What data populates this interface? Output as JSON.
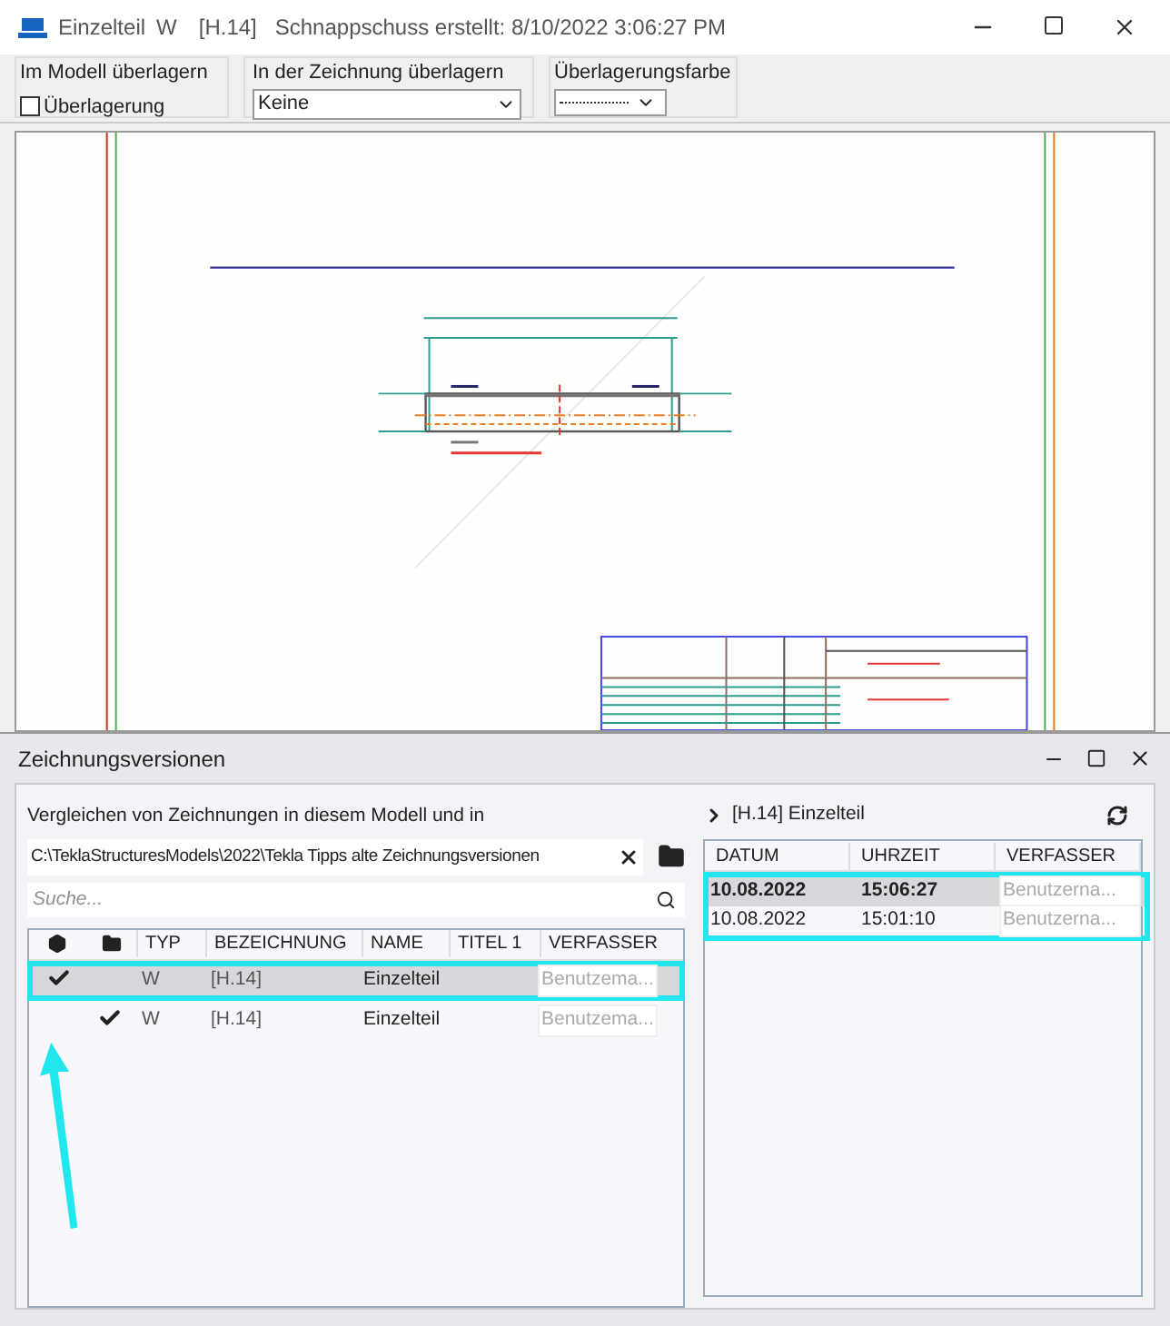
{
  "window": {
    "title": "Einzelteil",
    "type": "W",
    "mark": "[H.14]",
    "snapshot": "Schnappschuss erstellt: 8/10/2022 3:06:27 PM"
  },
  "toolbar": {
    "model_overlay": {
      "label": "Im Modell überlagern",
      "checkbox": {
        "label": "Überlagerung",
        "checked": false
      }
    },
    "drawing_overlay": {
      "label": "In der Zeichnung überlagern",
      "value": "Keine"
    },
    "overlay_color": {
      "label": "Überlagerungsfarbe"
    }
  },
  "panel": {
    "title": "Zeichnungsversionen",
    "compare_label": "Vergleichen von Zeichnungen in diesem Modell und in",
    "path": "C:\\TeklaStructuresModels\\2022\\Tekla Tipps alte Zeichnungsversionen",
    "search": {
      "placeholder": "Suche..."
    },
    "table": {
      "columns": [
        "TYP",
        "BEZEICHNUNG",
        "NAME",
        "TITEL 1",
        "VERFASSER"
      ],
      "rows": [
        {
          "selected": true,
          "in_model": true,
          "in_folder": false,
          "typ": "W",
          "bezeichnung": "[H.14]",
          "name": "Einzelteil",
          "verfasser": "Benutzema..."
        },
        {
          "selected": false,
          "in_model": false,
          "in_folder": true,
          "typ": "W",
          "bezeichnung": "[H.14]",
          "name": "Einzelteil",
          "verfasser": "Benutzema..."
        }
      ]
    },
    "versions": {
      "header": "[H.14] Einzelteil",
      "columns": [
        "DATUM",
        "UHRZEIT",
        "VERFASSER"
      ],
      "rows": [
        {
          "selected": true,
          "datum": "10.08.2022",
          "uhrzeit": "15:06:27",
          "verfasser": "Benutzerna..."
        },
        {
          "selected": false,
          "datum": "10.08.2022",
          "uhrzeit": "15:01:10",
          "verfasser": "Benutzerna..."
        }
      ]
    }
  }
}
